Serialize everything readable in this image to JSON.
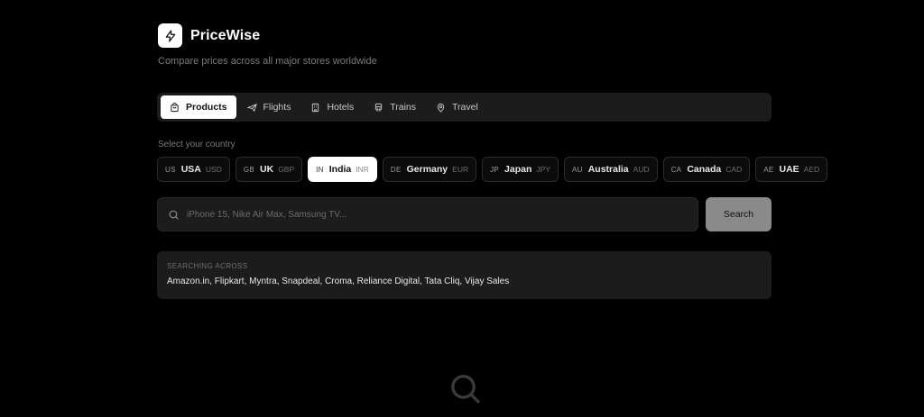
{
  "app": {
    "name": "PriceWise",
    "tagline": "Compare prices across all major stores worldwide"
  },
  "tabs": [
    {
      "label": "Products",
      "icon": "shopping-bag-icon",
      "active": true
    },
    {
      "label": "Flights",
      "icon": "plane-icon",
      "active": false
    },
    {
      "label": "Hotels",
      "icon": "building-icon",
      "active": false
    },
    {
      "label": "Trains",
      "icon": "train-icon",
      "active": false
    },
    {
      "label": "Travel",
      "icon": "map-pin-icon",
      "active": false
    }
  ],
  "country": {
    "label": "Select your country",
    "options": [
      {
        "code": "US",
        "name": "USA",
        "currency": "USD",
        "selected": false
      },
      {
        "code": "GB",
        "name": "UK",
        "currency": "GBP",
        "selected": false
      },
      {
        "code": "IN",
        "name": "India",
        "currency": "INR",
        "selected": true
      },
      {
        "code": "DE",
        "name": "Germany",
        "currency": "EUR",
        "selected": false
      },
      {
        "code": "JP",
        "name": "Japan",
        "currency": "JPY",
        "selected": false
      },
      {
        "code": "AU",
        "name": "Australia",
        "currency": "AUD",
        "selected": false
      },
      {
        "code": "CA",
        "name": "Canada",
        "currency": "CAD",
        "selected": false
      },
      {
        "code": "AE",
        "name": "UAE",
        "currency": "AED",
        "selected": false
      }
    ]
  },
  "search": {
    "value": "",
    "placeholder": "iPhone 15, Nike Air Max, Samsung TV...",
    "button_label": "Search"
  },
  "stores": {
    "title": "Searching across",
    "list": "Amazon.in, Flipkart, Myntra, Snapdeal, Croma, Reliance Digital, Tata Cliq, Vijay Sales"
  },
  "colors": {
    "background": "#000000",
    "panel": "#1c1c1c",
    "active": "#ffffff",
    "button": "#8a8a8a"
  }
}
